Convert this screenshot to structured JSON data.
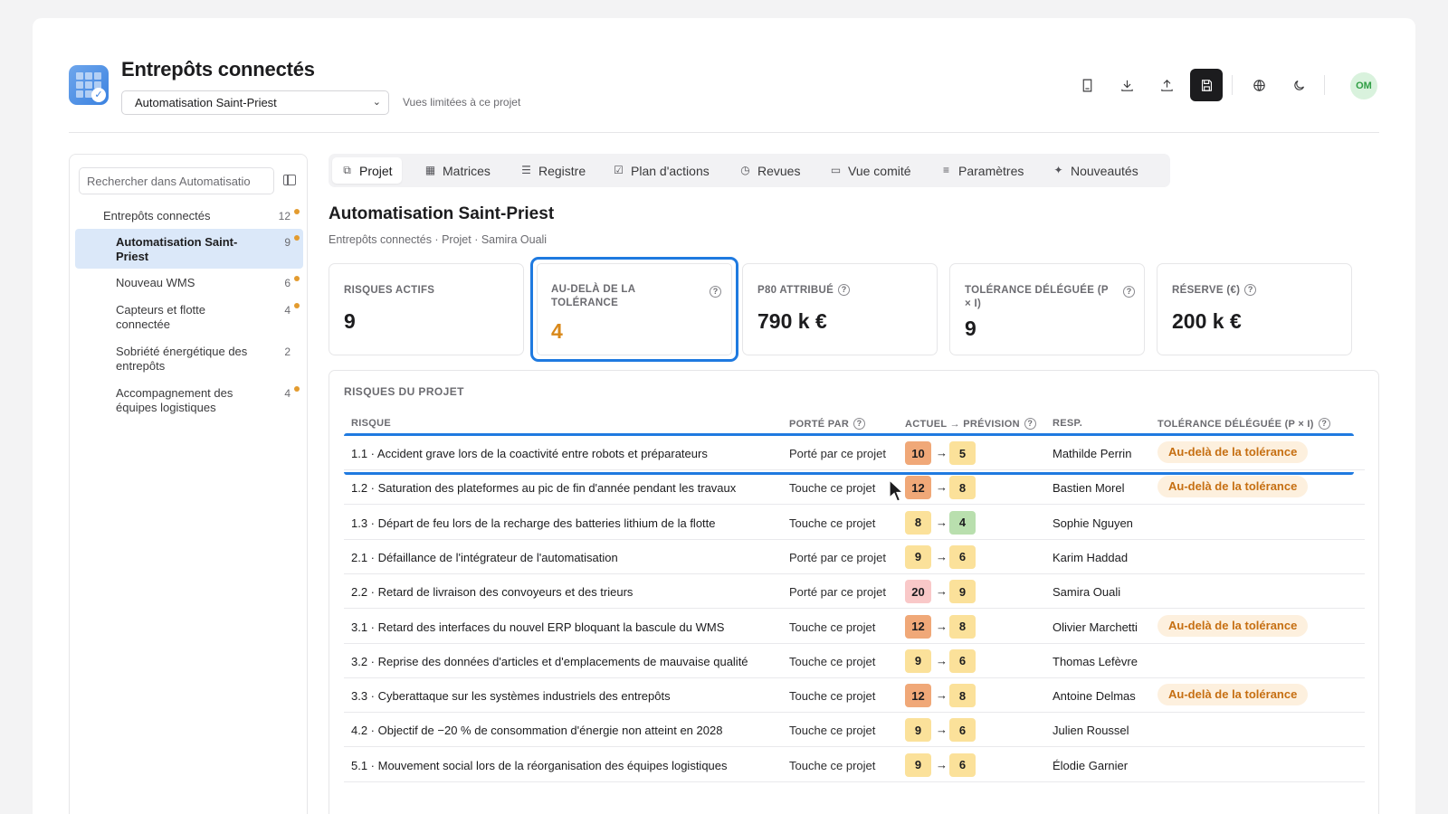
{
  "header": {
    "app_title": "Entrepôts connectés",
    "project_selected": "Automatisation Saint-Priest",
    "view_note": "Vues limitées à ce projet",
    "avatar_initials": "OM",
    "toolbar_icons": [
      "book-icon",
      "download-icon",
      "upload-icon",
      "save-icon",
      "globe-icon",
      "moon-icon"
    ]
  },
  "sidebar": {
    "search_placeholder": "Rechercher dans Automatisatio",
    "items": [
      {
        "label": "Entrepôts connectés",
        "count": "12",
        "dot": true,
        "active": false,
        "indent": 0
      },
      {
        "label": "Automatisation Saint-Priest",
        "count": "9",
        "dot": true,
        "active": true,
        "indent": 1
      },
      {
        "label": "Nouveau WMS",
        "count": "6",
        "dot": true,
        "active": false,
        "indent": 1
      },
      {
        "label": "Capteurs et flotte connectée",
        "count": "4",
        "dot": true,
        "active": false,
        "indent": 1
      },
      {
        "label": "Sobriété énergétique des entrepôts",
        "count": "2",
        "dot": false,
        "active": false,
        "indent": 1
      },
      {
        "label": "Accompagnement des équipes logistiques",
        "count": "4",
        "dot": true,
        "active": false,
        "indent": 1
      }
    ]
  },
  "tabs": [
    {
      "label": "Projet",
      "icon": "project-icon",
      "active": true
    },
    {
      "label": "Matrices",
      "icon": "grid-icon",
      "active": false
    },
    {
      "label": "Registre",
      "icon": "list-icon",
      "active": false
    },
    {
      "label": "Plan d'actions",
      "icon": "checkbox-icon",
      "active": false
    },
    {
      "label": "Revues",
      "icon": "clock-icon",
      "active": false
    },
    {
      "label": "Vue comité",
      "icon": "monitor-icon",
      "active": false
    },
    {
      "label": "Paramètres",
      "icon": "sliders-icon",
      "active": false
    },
    {
      "label": "Nouveautés",
      "icon": "sparkle-icon",
      "active": false
    }
  ],
  "page": {
    "title": "Automatisation Saint-Priest",
    "subtitle": "Entrepôts connectés · Projet · Samira Ouali"
  },
  "kpis": [
    {
      "label": "Risques actifs",
      "value": "9",
      "help": false
    },
    {
      "label": "Au-delà de la tolérance",
      "value": "4",
      "help": true
    },
    {
      "label": "P80 attribué",
      "value": "790 k €",
      "help": true
    },
    {
      "label": "Tolérance déléguée (P × I)",
      "value": "9",
      "help": true
    },
    {
      "label": "Réserve (€)",
      "value": "200 k €",
      "help": true
    }
  ],
  "risks": {
    "title": "RISQUES DU PROJET",
    "columns": {
      "risk": "RISQUE",
      "porte": "PORTÉ PAR",
      "actuel": "ACTUEL → PRÉVISION",
      "resp": "RESP.",
      "tol": "TOLÉRANCE DÉLÉGUÉE (P × I)"
    },
    "arrow": "→",
    "rows": [
      {
        "risk": "1.1 · Accident grave lors de la coactivité entre robots et préparateurs",
        "porte": "Porté par ce projet",
        "actuel": "10",
        "prevision": "5",
        "resp": "Mathilde Perrin",
        "tol": "Au-delà de la tolérance"
      },
      {
        "risk": "1.2 · Saturation des plateformes au pic de fin d'année pendant les travaux",
        "porte": "Touche ce projet",
        "actuel": "12",
        "prevision": "8",
        "resp": "Bastien Morel",
        "tol": "Au-delà de la tolérance"
      },
      {
        "risk": "1.3 · Départ de feu lors de la recharge des batteries lithium de la flotte",
        "porte": "Touche ce projet",
        "actuel": "8",
        "prevision": "4",
        "resp": "Sophie Nguyen",
        "tol": ""
      },
      {
        "risk": "2.1 · Défaillance de l'intégrateur de l'automatisation",
        "porte": "Porté par ce projet",
        "actuel": "9",
        "prevision": "6",
        "resp": "Karim Haddad",
        "tol": ""
      },
      {
        "risk": "2.2 · Retard de livraison des convoyeurs et des trieurs",
        "porte": "Porté par ce projet",
        "actuel": "20",
        "prevision": "9",
        "resp": "Samira Ouali",
        "tol": ""
      },
      {
        "risk": "3.1 · Retard des interfaces du nouvel ERP bloquant la bascule du WMS",
        "porte": "Touche ce projet",
        "actuel": "12",
        "prevision": "8",
        "resp": "Olivier Marchetti",
        "tol": "Au-delà de la tolérance"
      },
      {
        "risk": "3.2 · Reprise des données d'articles et d'emplacements de mauvaise qualité",
        "porte": "Touche ce projet",
        "actuel": "9",
        "prevision": "6",
        "resp": "Thomas Lefèvre",
        "tol": ""
      },
      {
        "risk": "3.3 · Cyberattaque sur les systèmes industriels des entrepôts",
        "porte": "Touche ce projet",
        "actuel": "12",
        "prevision": "8",
        "resp": "Antoine Delmas",
        "tol": "Au-delà de la tolérance"
      },
      {
        "risk": "4.2 · Objectif de −20 % de consommation d'énergie non atteint en 2028",
        "porte": "Touche ce projet",
        "actuel": "9",
        "prevision": "6",
        "resp": "Julien Roussel",
        "tol": ""
      },
      {
        "risk": "5.1 · Mouvement social lors de la réorganisation des équipes logistiques",
        "porte": "Touche ce projet",
        "actuel": "9",
        "prevision": "6",
        "resp": "Élodie Garnier",
        "tol": ""
      }
    ]
  },
  "colors": {
    "accent": "#1f7ae0",
    "warning_text": "#c66f12",
    "warning_bg": "#fdf0de",
    "kpi_orange": "#d9891b"
  }
}
